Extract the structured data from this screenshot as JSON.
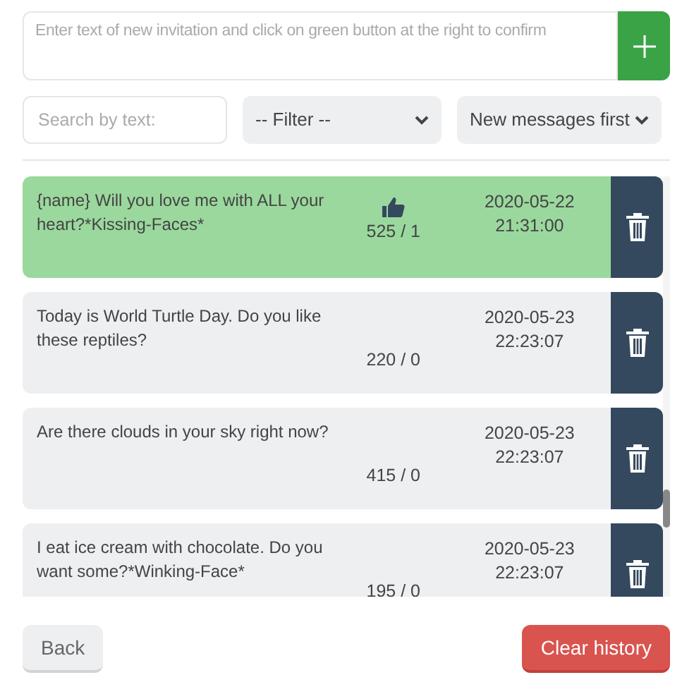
{
  "new_invitation": {
    "placeholder": "Enter text of new invitation and click on green button at the right to confirm"
  },
  "search": {
    "placeholder": "Search by text:"
  },
  "filter": {
    "value": "-- Filter --"
  },
  "sort": {
    "value": "New messages first"
  },
  "messages": [
    {
      "text": "{name} Will you love me with ALL your heart?*Kissing-Faces*",
      "liked": true,
      "counts": "525 / 1",
      "date": "2020-05-22",
      "time": "21:31:00",
      "selected": true
    },
    {
      "text": "Today is World Turtle Day. Do you like these reptiles?",
      "liked": false,
      "counts": "220 / 0",
      "date": "2020-05-23",
      "time": "22:23:07",
      "selected": false
    },
    {
      "text": "Are there clouds in your sky right now?",
      "liked": false,
      "counts": "415 / 0",
      "date": "2020-05-23",
      "time": "22:23:07",
      "selected": false
    },
    {
      "text": "I eat ice cream with chocolate. Do you want some?*Winking-Face*",
      "liked": false,
      "counts": "195 / 0",
      "date": "2020-05-23",
      "time": "22:23:07",
      "selected": false
    }
  ],
  "buttons": {
    "back": "Back",
    "clear": "Clear history"
  }
}
